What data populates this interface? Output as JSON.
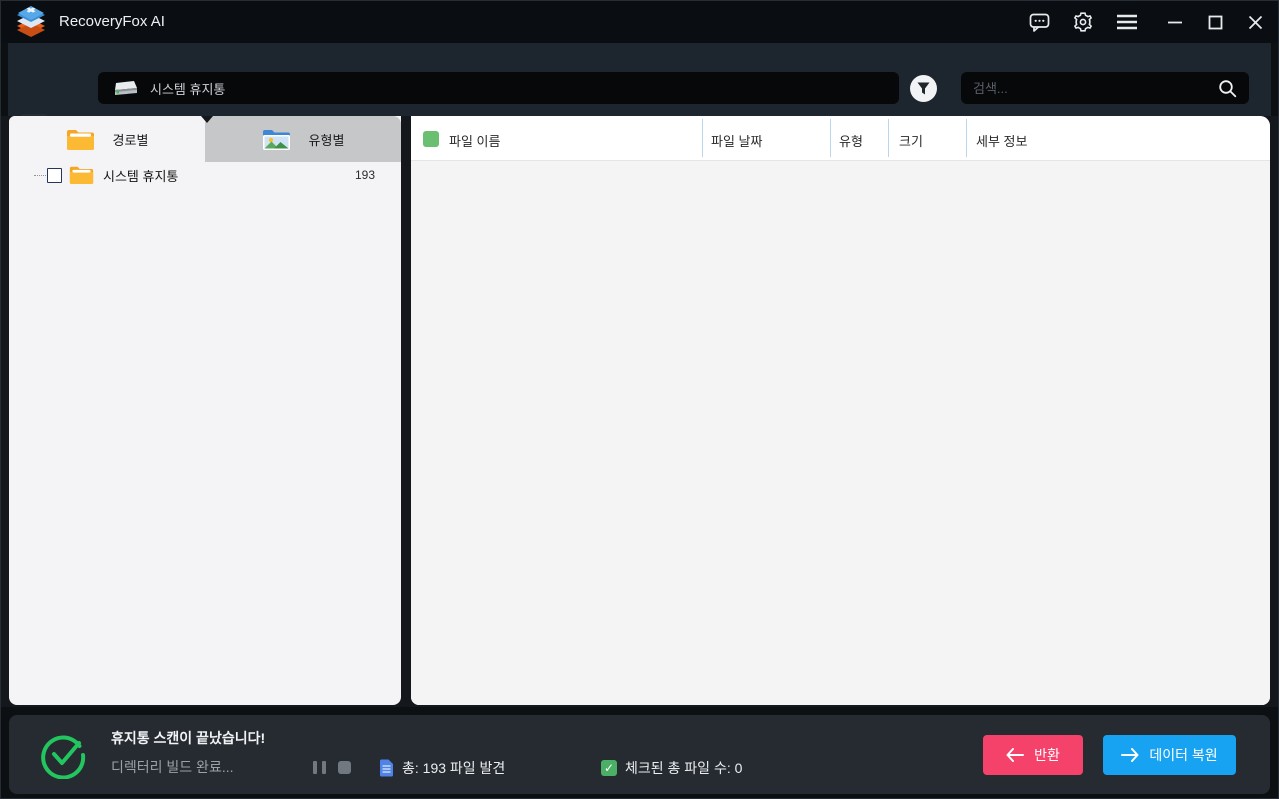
{
  "app": {
    "title": "RecoveryFox AI"
  },
  "titlebar": {
    "icons": {
      "feedback": "chat-bubble",
      "settings": "gear",
      "menu": "hamburger"
    },
    "window_controls": {
      "minimize": "line",
      "maximize": "square",
      "close": "x"
    }
  },
  "navbar": {
    "back_icon": "arrow-left",
    "forward_icon": "arrow-right",
    "path_field": {
      "icon": "hard-drive",
      "value": "시스템 휴지통"
    },
    "filter_icon": "funnel",
    "search_field": {
      "placeholder": "검색...",
      "icon": "magnifier"
    }
  },
  "sidebar": {
    "tabs": [
      {
        "label": "경로별",
        "icon": "folder",
        "active": true
      },
      {
        "label": "유형별",
        "icon": "image-folder",
        "active": false
      }
    ],
    "tree": {
      "items": [
        {
          "label": "시스템 휴지통",
          "count": "193",
          "checked": false,
          "icon": "folder"
        }
      ]
    }
  },
  "filelist": {
    "select_all_state": "green-filled",
    "columns": [
      "파일 이름",
      "파일 날짜",
      "유형",
      "크기",
      "세부 정보"
    ],
    "rows": []
  },
  "statusbar": {
    "status_icon": "check-circle",
    "title": "휴지통 스캔이 끝났습니다!",
    "subtitle": "디렉터리 빌드 완료...",
    "pause_icon": "pause",
    "stop_icon": "stop",
    "total_files": "총: 193 파일 발견",
    "checked_files": "체크된 총 파일 수: 0",
    "checked_icon": "checked-checkbox",
    "total_icon": "document",
    "buttons": {
      "return": {
        "label": "반환",
        "icon": "arrow-left",
        "color": "#f4426b"
      },
      "recover": {
        "label": "데이터 복원",
        "icon": "arrow-right",
        "color": "#18a3f2"
      }
    }
  },
  "colors": {
    "titlebar_bg": "#0a0e12",
    "navbar_bg": "#1d262e",
    "input_bg": "#060809",
    "sidebar_bg": "#f4f4f6",
    "inactive_tab_bg": "#c6c7c9",
    "list_header_bg": "#ffffff",
    "list_bg": "#f4f4f5",
    "header_separator": "#b9d6ec",
    "statusbar_bg": "#262b32",
    "success_green": "#22c55e",
    "checkbox_green": "#6abf70",
    "button_pink": "#f4426b",
    "button_blue": "#18a3f2"
  }
}
